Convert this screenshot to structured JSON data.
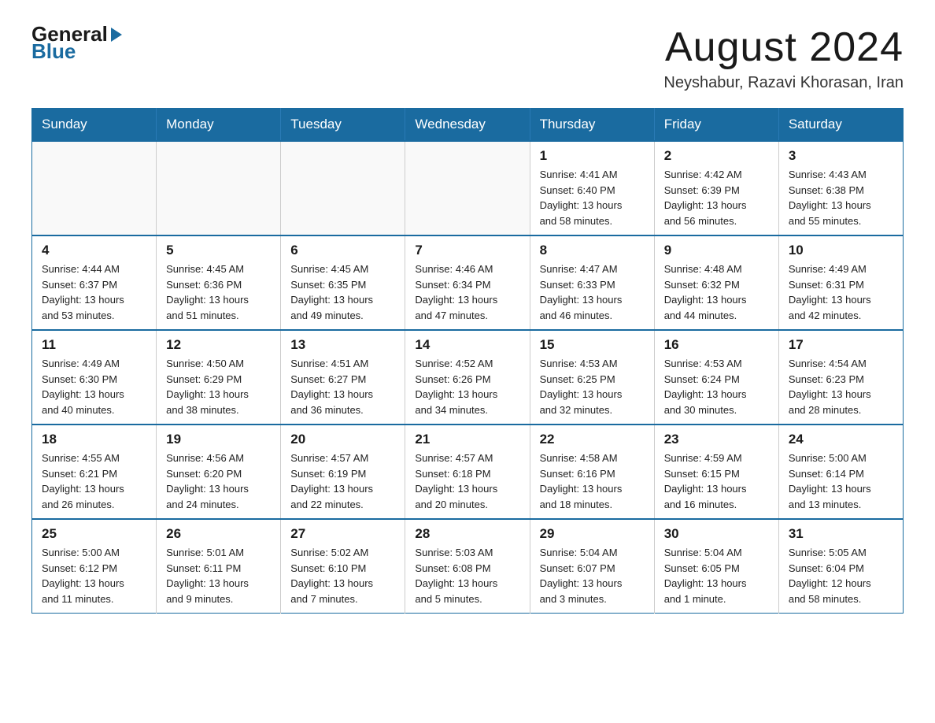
{
  "logo": {
    "general": "General",
    "blue": "Blue"
  },
  "header": {
    "month_title": "August 2024",
    "location": "Neyshabur, Razavi Khorasan, Iran"
  },
  "days_of_week": [
    "Sunday",
    "Monday",
    "Tuesday",
    "Wednesday",
    "Thursday",
    "Friday",
    "Saturday"
  ],
  "weeks": [
    [
      {
        "day": "",
        "info": ""
      },
      {
        "day": "",
        "info": ""
      },
      {
        "day": "",
        "info": ""
      },
      {
        "day": "",
        "info": ""
      },
      {
        "day": "1",
        "info": "Sunrise: 4:41 AM\nSunset: 6:40 PM\nDaylight: 13 hours\nand 58 minutes."
      },
      {
        "day": "2",
        "info": "Sunrise: 4:42 AM\nSunset: 6:39 PM\nDaylight: 13 hours\nand 56 minutes."
      },
      {
        "day": "3",
        "info": "Sunrise: 4:43 AM\nSunset: 6:38 PM\nDaylight: 13 hours\nand 55 minutes."
      }
    ],
    [
      {
        "day": "4",
        "info": "Sunrise: 4:44 AM\nSunset: 6:37 PM\nDaylight: 13 hours\nand 53 minutes."
      },
      {
        "day": "5",
        "info": "Sunrise: 4:45 AM\nSunset: 6:36 PM\nDaylight: 13 hours\nand 51 minutes."
      },
      {
        "day": "6",
        "info": "Sunrise: 4:45 AM\nSunset: 6:35 PM\nDaylight: 13 hours\nand 49 minutes."
      },
      {
        "day": "7",
        "info": "Sunrise: 4:46 AM\nSunset: 6:34 PM\nDaylight: 13 hours\nand 47 minutes."
      },
      {
        "day": "8",
        "info": "Sunrise: 4:47 AM\nSunset: 6:33 PM\nDaylight: 13 hours\nand 46 minutes."
      },
      {
        "day": "9",
        "info": "Sunrise: 4:48 AM\nSunset: 6:32 PM\nDaylight: 13 hours\nand 44 minutes."
      },
      {
        "day": "10",
        "info": "Sunrise: 4:49 AM\nSunset: 6:31 PM\nDaylight: 13 hours\nand 42 minutes."
      }
    ],
    [
      {
        "day": "11",
        "info": "Sunrise: 4:49 AM\nSunset: 6:30 PM\nDaylight: 13 hours\nand 40 minutes."
      },
      {
        "day": "12",
        "info": "Sunrise: 4:50 AM\nSunset: 6:29 PM\nDaylight: 13 hours\nand 38 minutes."
      },
      {
        "day": "13",
        "info": "Sunrise: 4:51 AM\nSunset: 6:27 PM\nDaylight: 13 hours\nand 36 minutes."
      },
      {
        "day": "14",
        "info": "Sunrise: 4:52 AM\nSunset: 6:26 PM\nDaylight: 13 hours\nand 34 minutes."
      },
      {
        "day": "15",
        "info": "Sunrise: 4:53 AM\nSunset: 6:25 PM\nDaylight: 13 hours\nand 32 minutes."
      },
      {
        "day": "16",
        "info": "Sunrise: 4:53 AM\nSunset: 6:24 PM\nDaylight: 13 hours\nand 30 minutes."
      },
      {
        "day": "17",
        "info": "Sunrise: 4:54 AM\nSunset: 6:23 PM\nDaylight: 13 hours\nand 28 minutes."
      }
    ],
    [
      {
        "day": "18",
        "info": "Sunrise: 4:55 AM\nSunset: 6:21 PM\nDaylight: 13 hours\nand 26 minutes."
      },
      {
        "day": "19",
        "info": "Sunrise: 4:56 AM\nSunset: 6:20 PM\nDaylight: 13 hours\nand 24 minutes."
      },
      {
        "day": "20",
        "info": "Sunrise: 4:57 AM\nSunset: 6:19 PM\nDaylight: 13 hours\nand 22 minutes."
      },
      {
        "day": "21",
        "info": "Sunrise: 4:57 AM\nSunset: 6:18 PM\nDaylight: 13 hours\nand 20 minutes."
      },
      {
        "day": "22",
        "info": "Sunrise: 4:58 AM\nSunset: 6:16 PM\nDaylight: 13 hours\nand 18 minutes."
      },
      {
        "day": "23",
        "info": "Sunrise: 4:59 AM\nSunset: 6:15 PM\nDaylight: 13 hours\nand 16 minutes."
      },
      {
        "day": "24",
        "info": "Sunrise: 5:00 AM\nSunset: 6:14 PM\nDaylight: 13 hours\nand 13 minutes."
      }
    ],
    [
      {
        "day": "25",
        "info": "Sunrise: 5:00 AM\nSunset: 6:12 PM\nDaylight: 13 hours\nand 11 minutes."
      },
      {
        "day": "26",
        "info": "Sunrise: 5:01 AM\nSunset: 6:11 PM\nDaylight: 13 hours\nand 9 minutes."
      },
      {
        "day": "27",
        "info": "Sunrise: 5:02 AM\nSunset: 6:10 PM\nDaylight: 13 hours\nand 7 minutes."
      },
      {
        "day": "28",
        "info": "Sunrise: 5:03 AM\nSunset: 6:08 PM\nDaylight: 13 hours\nand 5 minutes."
      },
      {
        "day": "29",
        "info": "Sunrise: 5:04 AM\nSunset: 6:07 PM\nDaylight: 13 hours\nand 3 minutes."
      },
      {
        "day": "30",
        "info": "Sunrise: 5:04 AM\nSunset: 6:05 PM\nDaylight: 13 hours\nand 1 minute."
      },
      {
        "day": "31",
        "info": "Sunrise: 5:05 AM\nSunset: 6:04 PM\nDaylight: 12 hours\nand 58 minutes."
      }
    ]
  ]
}
